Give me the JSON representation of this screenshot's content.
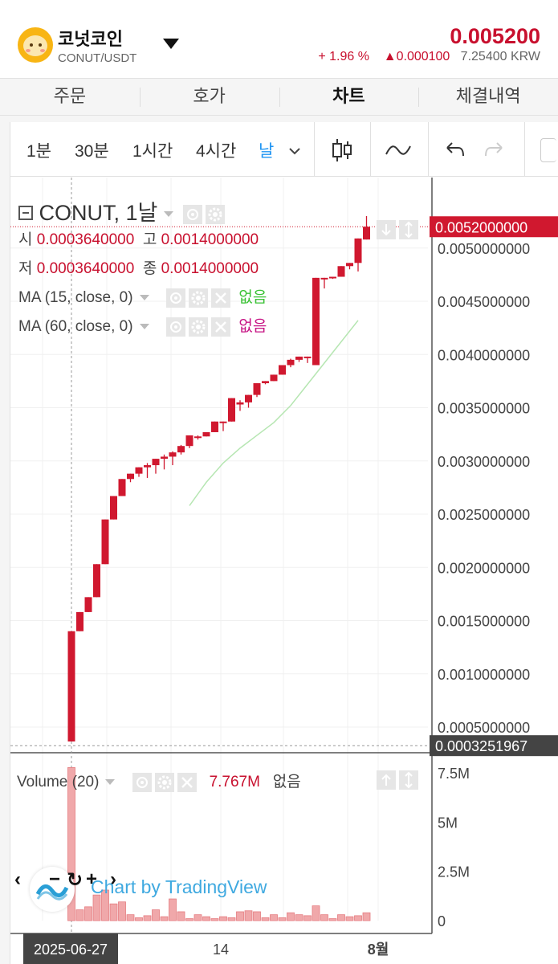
{
  "header": {
    "coin_name": "코넛코인",
    "pair": "CONUT/USDT",
    "price": "0.005200",
    "change_pct": "+ 1.96 %",
    "change_abs": "0.000100",
    "krw": "7.25400 KRW"
  },
  "tabs": [
    "주문",
    "호가",
    "차트",
    "체결내역"
  ],
  "active_tab": "차트",
  "toolbar": {
    "intervals": [
      "1분",
      "30분",
      "1시간",
      "4시간",
      "날"
    ],
    "active_interval": "날"
  },
  "legend": {
    "symbol": "CONUT, 1날",
    "open_label": "시",
    "open": "0.0003640000",
    "high_label": "고",
    "high": "0.0014000000",
    "low_label": "저",
    "low": "0.0003640000",
    "close_label": "종",
    "close": "0.0014000000",
    "ma1": "MA (15, close, 0)",
    "ma1_value": "없음",
    "ma2": "MA (60, close, 0)",
    "ma2_value": "없음",
    "volume": "Volume (20)",
    "volume_value": "7.767M",
    "volume_extra": "없음"
  },
  "watermark": "Chart by TradingView",
  "colors": {
    "up": "#d0182f",
    "ma15": "#3bc236",
    "ma60": "#c71585",
    "volume": "#f0a8aa"
  },
  "chart_data": {
    "type": "candlestick",
    "price_axis_ticks": [
      "0.0050000000",
      "0.0045000000",
      "0.0040000000",
      "0.0035000000",
      "0.0030000000",
      "0.0025000000",
      "0.0020000000",
      "0.0015000000",
      "0.0010000000",
      "0.0005000000"
    ],
    "current_price_label": "0.0052000000",
    "crosshair_price_label": "0.0003251967",
    "volume_axis_ticks": [
      "7.5M",
      "5M",
      "2.5M",
      "0"
    ],
    "x_ticks": [
      "14",
      "8월"
    ],
    "crosshair_date_label": "2025-06-27",
    "candles": [
      {
        "o": 0.000364,
        "c": 0.0014,
        "h": 0.0014,
        "l": 0.000364,
        "v": 7.767
      },
      {
        "o": 0.0014,
        "c": 0.00158,
        "h": 0.00158,
        "l": 0.0014,
        "v": 0.55
      },
      {
        "o": 0.00158,
        "c": 0.00172,
        "h": 0.00172,
        "l": 0.00158,
        "v": 0.7
      },
      {
        "o": 0.00172,
        "c": 0.00203,
        "h": 0.00203,
        "l": 0.00172,
        "v": 1.3
      },
      {
        "o": 0.00203,
        "c": 0.00245,
        "h": 0.00245,
        "l": 0.00203,
        "v": 1.55
      },
      {
        "o": 0.00245,
        "c": 0.00267,
        "h": 0.00267,
        "l": 0.00245,
        "v": 0.85
      },
      {
        "o": 0.00267,
        "c": 0.00283,
        "h": 0.00283,
        "l": 0.00267,
        "v": 0.95
      },
      {
        "o": 0.00283,
        "c": 0.00288,
        "h": 0.00288,
        "l": 0.0028,
        "v": 0.3
      },
      {
        "o": 0.00288,
        "c": 0.00294,
        "h": 0.00294,
        "l": 0.00285,
        "v": 0.15
      },
      {
        "o": 0.00294,
        "c": 0.00296,
        "h": 0.00298,
        "l": 0.00284,
        "v": 0.25
      },
      {
        "o": 0.00296,
        "c": 0.00302,
        "h": 0.00302,
        "l": 0.00288,
        "v": 0.55
      },
      {
        "o": 0.00302,
        "c": 0.00304,
        "h": 0.00306,
        "l": 0.00292,
        "v": 0.2
      },
      {
        "o": 0.00304,
        "c": 0.00308,
        "h": 0.00309,
        "l": 0.00296,
        "v": 1.1
      },
      {
        "o": 0.00308,
        "c": 0.00314,
        "h": 0.00315,
        "l": 0.00306,
        "v": 0.45
      },
      {
        "o": 0.00314,
        "c": 0.00324,
        "h": 0.00324,
        "l": 0.00312,
        "v": 0.1
      },
      {
        "o": 0.00322,
        "c": 0.00323,
        "h": 0.00324,
        "l": 0.0032,
        "v": 0.3
      },
      {
        "o": 0.00323,
        "c": 0.00327,
        "h": 0.00327,
        "l": 0.00323,
        "v": 0.2
      },
      {
        "o": 0.00327,
        "c": 0.00337,
        "h": 0.00337,
        "l": 0.00327,
        "v": 0.1
      },
      {
        "o": 0.00337,
        "c": 0.00337,
        "h": 0.00337,
        "l": 0.00328,
        "v": 0.2
      },
      {
        "o": 0.00337,
        "c": 0.00359,
        "h": 0.00359,
        "l": 0.00337,
        "v": 0.15
      },
      {
        "o": 0.00353,
        "c": 0.00355,
        "h": 0.00357,
        "l": 0.00347,
        "v": 0.45
      },
      {
        "o": 0.00355,
        "c": 0.00362,
        "h": 0.00362,
        "l": 0.0035,
        "v": 0.5
      },
      {
        "o": 0.00362,
        "c": 0.00373,
        "h": 0.00373,
        "l": 0.0036,
        "v": 0.45
      },
      {
        "o": 0.00373,
        "c": 0.00375,
        "h": 0.00375,
        "l": 0.00372,
        "v": 0.15
      },
      {
        "o": 0.00375,
        "c": 0.00381,
        "h": 0.00381,
        "l": 0.00375,
        "v": 0.3
      },
      {
        "o": 0.00381,
        "c": 0.0039,
        "h": 0.0039,
        "l": 0.00381,
        "v": 0.15
      },
      {
        "o": 0.0039,
        "c": 0.00395,
        "h": 0.00396,
        "l": 0.00388,
        "v": 0.4
      },
      {
        "o": 0.00395,
        "c": 0.00398,
        "h": 0.00398,
        "l": 0.00393,
        "v": 0.3
      },
      {
        "o": 0.00398,
        "c": 0.00398,
        "h": 0.00398,
        "l": 0.00392,
        "v": 0.25
      },
      {
        "o": 0.0039,
        "c": 0.00472,
        "h": 0.00472,
        "l": 0.0039,
        "v": 0.75
      },
      {
        "o": 0.00472,
        "c": 0.00472,
        "h": 0.00472,
        "l": 0.00462,
        "v": 0.3
      },
      {
        "o": 0.00472,
        "c": 0.00473,
        "h": 0.00473,
        "l": 0.00471,
        "v": 0.1
      },
      {
        "o": 0.00473,
        "c": 0.00483,
        "h": 0.00483,
        "l": 0.00473,
        "v": 0.3
      },
      {
        "o": 0.00483,
        "c": 0.00486,
        "h": 0.00486,
        "l": 0.0048,
        "v": 0.2
      },
      {
        "o": 0.00486,
        "c": 0.00509,
        "h": 0.00509,
        "l": 0.00478,
        "v": 0.25
      },
      {
        "o": 0.00508,
        "c": 0.0052,
        "h": 0.0053,
        "l": 0.00508,
        "v": 0.4
      }
    ],
    "ma15": [
      {
        "i": 14,
        "v": 0.00258
      },
      {
        "i": 16,
        "v": 0.0028
      },
      {
        "i": 18,
        "v": 0.00298
      },
      {
        "i": 20,
        "v": 0.00312
      },
      {
        "i": 22,
        "v": 0.00324
      },
      {
        "i": 24,
        "v": 0.00336
      },
      {
        "i": 26,
        "v": 0.00352
      },
      {
        "i": 28,
        "v": 0.00372
      },
      {
        "i": 30,
        "v": 0.00392
      },
      {
        "i": 32,
        "v": 0.00412
      },
      {
        "i": 34,
        "v": 0.00432
      }
    ]
  }
}
